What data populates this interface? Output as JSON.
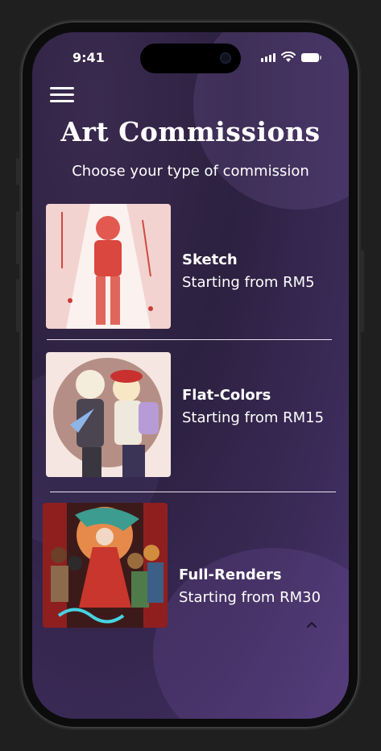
{
  "status_bar": {
    "time": "9:41"
  },
  "header": {
    "title": "Art Commissions",
    "subtitle": "Choose your type of commission"
  },
  "commissions": [
    {
      "name": "Sketch",
      "price": "Starting from RM5",
      "thumb_desc": "red pencil sketch"
    },
    {
      "name": "Flat-Colors",
      "price": "Starting from RM15",
      "thumb_desc": "flat colored illustration"
    },
    {
      "name": "Full-Renders",
      "price": "Starting from RM30",
      "thumb_desc": "fully rendered illustration"
    }
  ],
  "colors": {
    "background": "#2f2345",
    "accent": "#ffffff"
  }
}
